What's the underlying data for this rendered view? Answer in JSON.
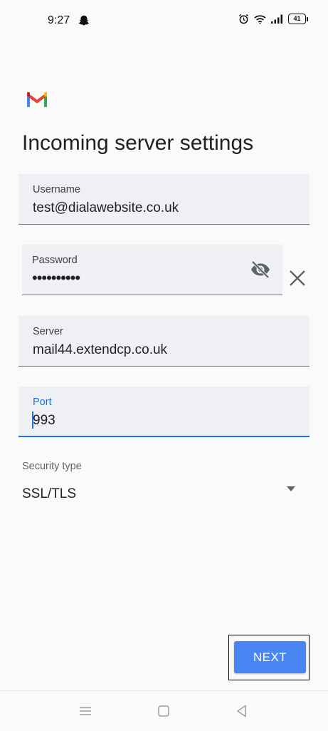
{
  "status_bar": {
    "time": "9:27",
    "battery": "41",
    "icons": [
      "snapchat-ghost-icon",
      "alarm-icon",
      "wifi-icon",
      "signal-icon",
      "battery-icon"
    ]
  },
  "app": {
    "logo": "gmail-logo"
  },
  "title": "Incoming server settings",
  "fields": {
    "username": {
      "label": "Username",
      "value": "test@dialawebsite.co.uk"
    },
    "password": {
      "label": "Password",
      "value": "••••••••••"
    },
    "server": {
      "label": "Server",
      "value": "mail44.extendcp.co.uk"
    },
    "port": {
      "label": "Port",
      "value": "993"
    }
  },
  "security": {
    "label": "Security type",
    "value": "SSL/TLS"
  },
  "next_label": "NEXT",
  "colors": {
    "accent": "#1a73e8",
    "button": "#4a86f3",
    "field_bg": "#eef0f3"
  }
}
